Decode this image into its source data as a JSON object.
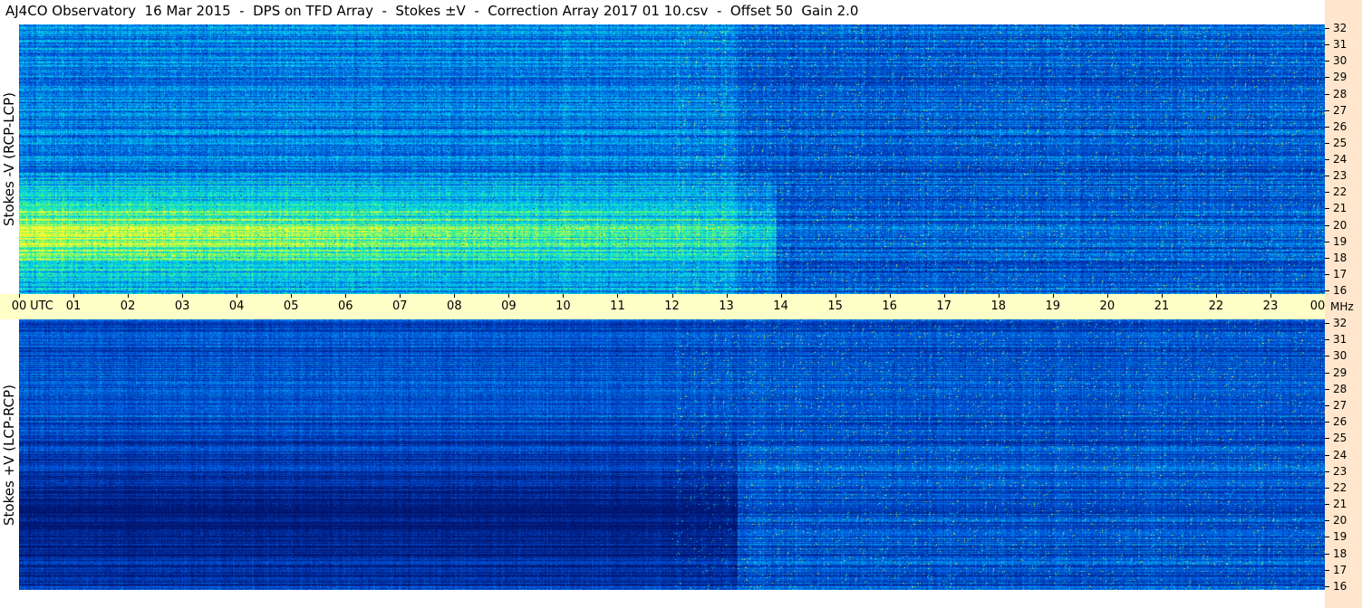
{
  "title": "AJ4CO Observatory  16 Mar 2015  -  DPS on TFD Array  -  Stokes ±V  -  Correction Array 2017 01 10.csv  -  Offset 50  Gain 2.0",
  "chart_data": {
    "type": "heatmap",
    "title": "AJ4CO Observatory  16 Mar 2015  -  DPS on TFD Array  -  Stokes ±V  -  Correction Array 2017 01 10.csv  -  Offset 50  Gain 2.0",
    "xlabel": "UTC",
    "x_unit_label": "UTC",
    "y_unit_label": "MHz",
    "xlim": [
      0,
      24
    ],
    "ylim": [
      16,
      32
    ],
    "x_ticks": [
      "00",
      "01",
      "02",
      "03",
      "04",
      "05",
      "06",
      "07",
      "08",
      "09",
      "10",
      "11",
      "12",
      "13",
      "14",
      "15",
      "16",
      "17",
      "18",
      "19",
      "20",
      "21",
      "22",
      "23",
      "00"
    ],
    "y_ticks": [
      "32",
      "31",
      "30",
      "29",
      "28",
      "27",
      "26",
      "25",
      "24",
      "23",
      "22",
      "21",
      "20",
      "19",
      "18",
      "17",
      "16"
    ],
    "panels": [
      {
        "name": "Stokes -V (RCP-LCP)",
        "ylabel": "Stokes -V (RCP-LCP)",
        "base_color": "#1a78e6"
      },
      {
        "name": "Stokes +V (LCP-RCP)",
        "ylabel": "Stokes +V (LCP-RCP)",
        "base_color": "#0a46d2"
      }
    ]
  },
  "colors": {
    "time_axis_bg": "#ffffc8",
    "freq_strip_bg": "#ffe6cc"
  }
}
